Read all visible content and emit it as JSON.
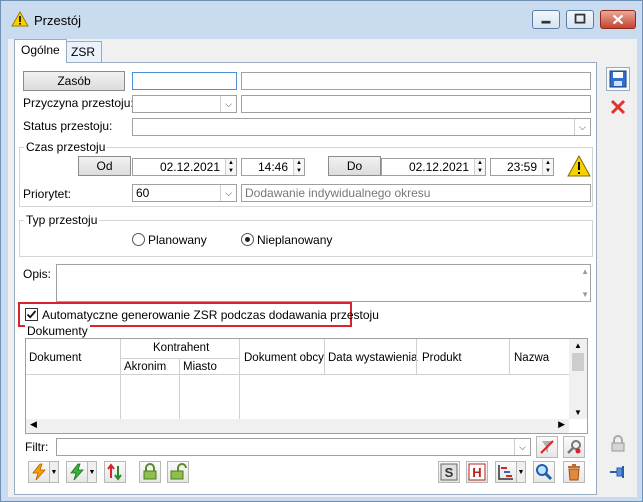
{
  "window": {
    "title": "Przestój"
  },
  "tabs": [
    {
      "label": "Ogólne"
    },
    {
      "label": "ZSR"
    }
  ],
  "form": {
    "zasob_button": "Zasób",
    "przyczyna_label": "Przyczyna przestoju:",
    "status_label": "Status przestoju:",
    "czas_group": "Czas przestoju",
    "od_button": "Od",
    "do_button": "Do",
    "od_date": "02.12.2021",
    "od_time": "14:46",
    "do_date": "02.12.2021",
    "do_time": "23:59",
    "priorytet_label": "Priorytet:",
    "priorytet_value": "60",
    "okres_placeholder": "Dodawanie indywidualnego okresu",
    "typ_group": "Typ przestoju",
    "planowany": "Planowany",
    "nieplanowany": "Nieplanowany",
    "opis_label": "Opis:",
    "auto_zsr": "Automatyczne generowanie ZSR podczas dodawania przestoju",
    "dokumenty_group": "Dokumenty",
    "filtr_label": "Filtr:"
  },
  "grid": {
    "headers": {
      "dokument": "Dokument",
      "kontrahent": "Kontrahent",
      "akronim": "Akronim",
      "miasto": "Miasto",
      "dokument_obcy": "Dokument obcy",
      "data_wystawienia": "Data wystawienia",
      "produkt": "Produkt",
      "nazwa": "Nazwa"
    }
  },
  "colors": {
    "accent": "#d9222a",
    "frame": "#c9dbee"
  }
}
